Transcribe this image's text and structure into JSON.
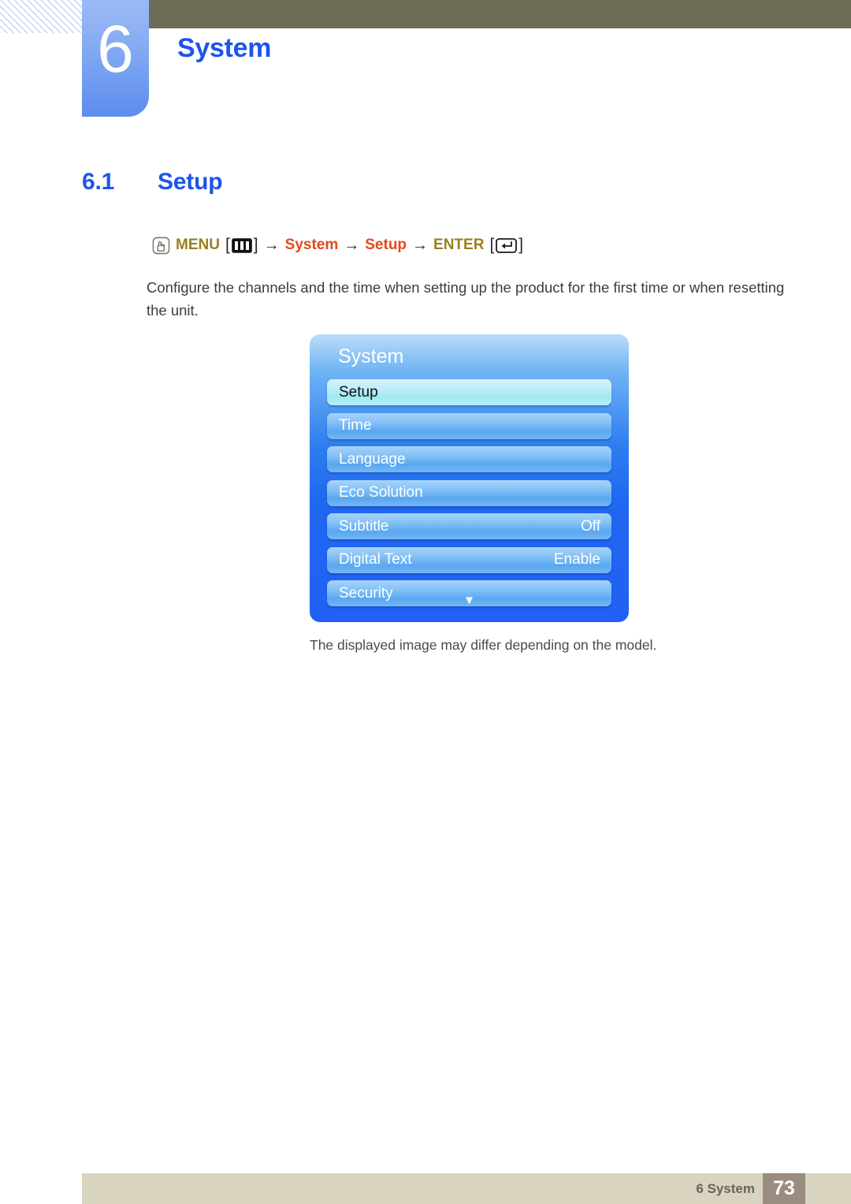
{
  "header": {
    "chapter_number": "6",
    "chapter_title": "System",
    "bar_color": "#6d6c57",
    "tab_color": "#6e9bf0",
    "accent_blue": "#1c54ec"
  },
  "section": {
    "number": "6.1",
    "title": "Setup"
  },
  "path": {
    "press_icon": "hand-press-icon",
    "menu_label": "MENU",
    "menu_key_icon": "menu-key-icon",
    "bracket_open": "[",
    "bracket_close": "]",
    "arrow": "→",
    "item1": "System",
    "item2": "Setup",
    "enter_label": "ENTER",
    "enter_key_icon": "enter-key-icon",
    "menu_color": "#9a7f1e",
    "item_color": "#e2491c"
  },
  "body": {
    "paragraph": "Configure the channels and the time when setting up the product for the first time or when resetting the unit."
  },
  "osd": {
    "title": "System",
    "down_arrow": "▼",
    "rows": [
      {
        "label": "Setup",
        "value": "",
        "selected": true
      },
      {
        "label": "Time",
        "value": "",
        "selected": false
      },
      {
        "label": "Language",
        "value": "",
        "selected": false
      },
      {
        "label": "Eco Solution",
        "value": "",
        "selected": false
      },
      {
        "label": "Subtitle",
        "value": "Off",
        "selected": false
      },
      {
        "label": "Digital Text",
        "value": "Enable",
        "selected": false
      },
      {
        "label": "Security",
        "value": "",
        "selected": false
      }
    ],
    "caption": "The displayed image may differ depending on the model."
  },
  "footer": {
    "text": "6 System",
    "page_number": "73",
    "bar_color": "#d8d4c0",
    "page_box_color": "#9b8c80"
  }
}
